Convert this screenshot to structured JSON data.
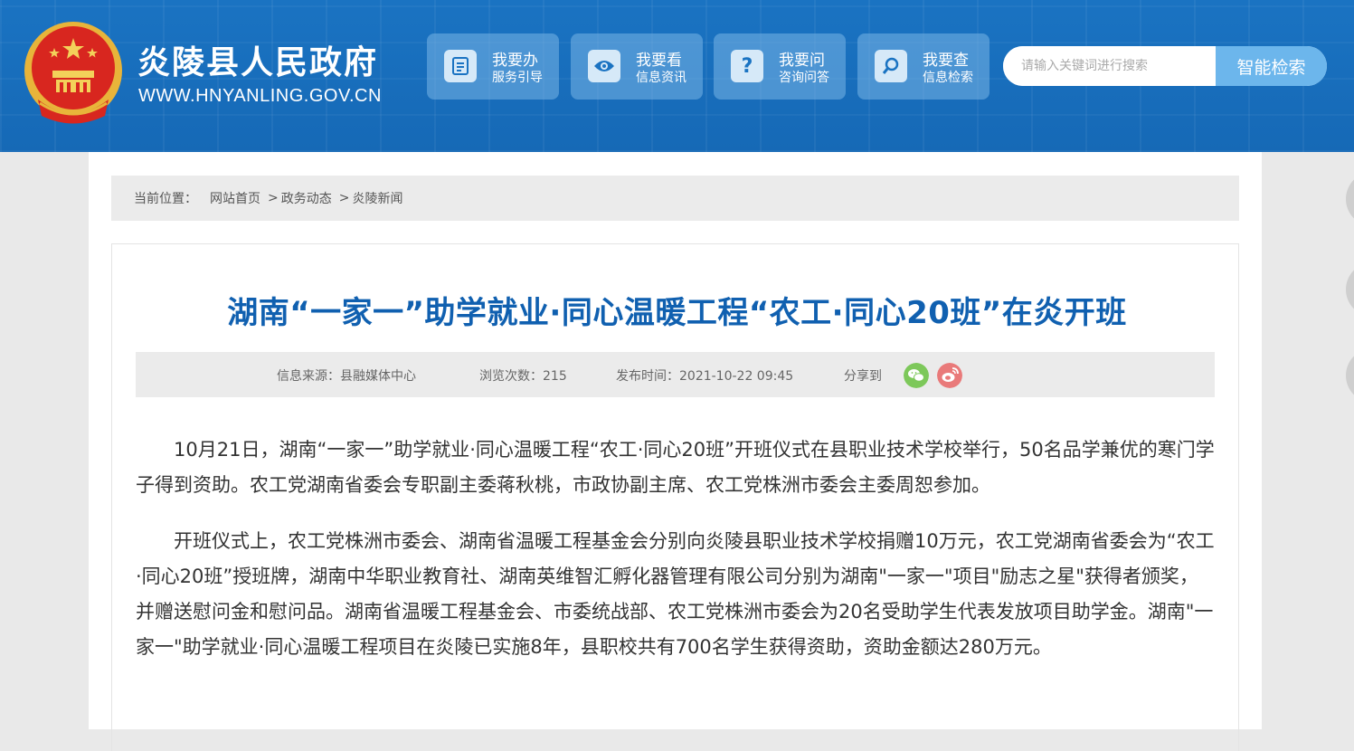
{
  "header": {
    "site_name": "炎陵县人民政府",
    "site_url": "WWW.HNYANLING.GOV.CN",
    "nav": [
      {
        "title": "我要办",
        "subtitle": "服务引导",
        "icon": "document-icon"
      },
      {
        "title": "我要看",
        "subtitle": "信息资讯",
        "icon": "eye-icon"
      },
      {
        "title": "我要问",
        "subtitle": "咨询问答",
        "icon": "question-icon"
      },
      {
        "title": "我要查",
        "subtitle": "信息检索",
        "icon": "search-icon"
      }
    ],
    "search": {
      "placeholder": "请输入关键词进行搜索",
      "button_label": "智能检索"
    }
  },
  "breadcrumb": {
    "label": "当前位置：",
    "items": [
      "网站首页",
      "政务动态",
      "炎陵新闻"
    ],
    "separator": ">"
  },
  "article": {
    "title": "湖南“一家一”助学就业·同心温暖工程“农工·同心20班”在炎开班",
    "meta": {
      "source": "信息来源：县融媒体中心",
      "views": "浏览次数：215",
      "published": "发布时间：2021-10-22 09:45",
      "share_label": "分享到"
    },
    "paragraphs": [
      "10月21日，湖南“一家一”助学就业·同心温暖工程“农工·同心20班”开班仪式在县职业技术学校举行，50名品学兼优的寒门学子得到资助。农工党湖南省委会专职副主委蒋秋桃，市政协副主席、农工党株洲市委会主委周恕参加。",
      "开班仪式上，农工党株洲市委会、湖南省温暖工程基金会分别向炎陵县职业技术学校捐赠10万元，农工党湖南省委会为“农工·同心20班”授班牌，湖南中华职业教育社、湖南英维智汇孵化器管理有限公司分别为湖南\"一家一\"项目\"励志之星\"获得者颁奖，并赠送慰问金和慰问品。湖南省温暖工程基金会、市委统战部、农工党株洲市委会为20名受助学生代表发放项目助学金。湖南\"一家一\"助学就业·同心温暖工程项目在炎陵已实施8年，县职校共有700名学生获得资助，资助金额达280万元。"
    ]
  },
  "colors": {
    "header_blue": "#1a73c2",
    "title_blue": "#1060b0",
    "wechat_green": "#7dc85a",
    "weibo_red": "#e97a7a"
  }
}
